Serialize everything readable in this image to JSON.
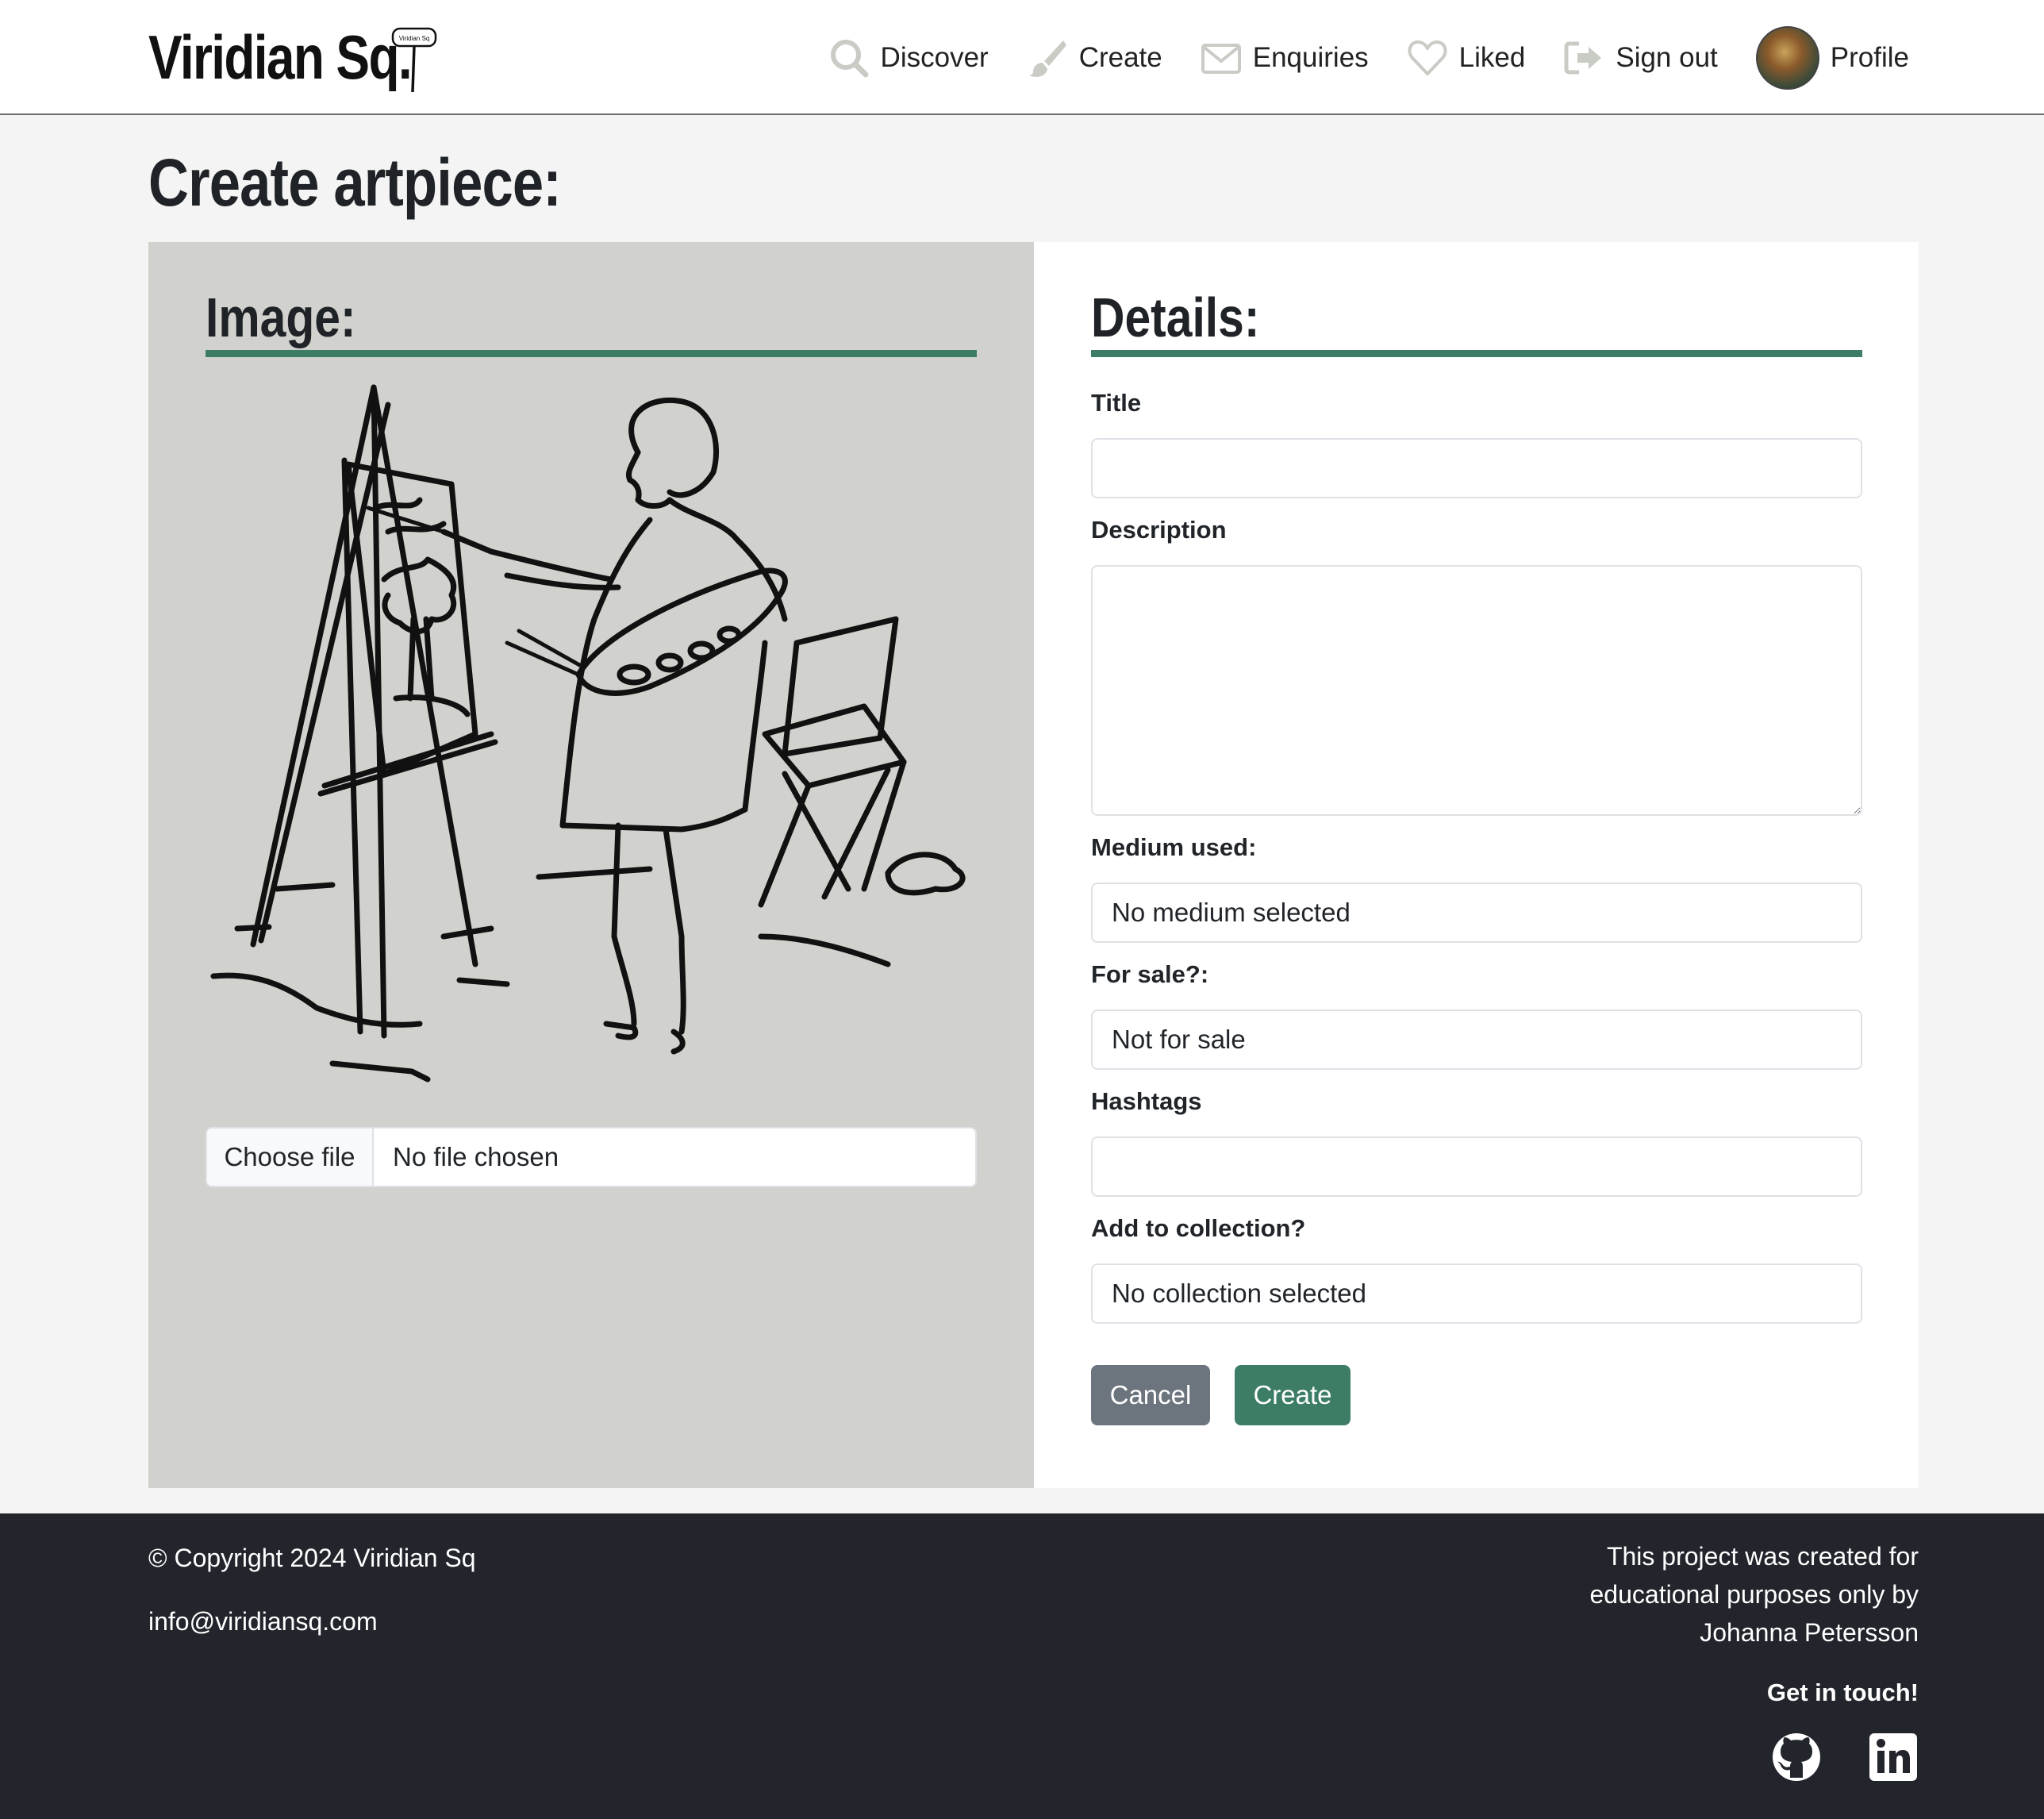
{
  "brand": {
    "name": "Viridian Sq.",
    "sign_text": "Viridian Sq"
  },
  "nav": [
    {
      "label": "Discover",
      "icon": "search-icon"
    },
    {
      "label": "Create",
      "icon": "brush-icon"
    },
    {
      "label": "Enquiries",
      "icon": "envelope-icon"
    },
    {
      "label": "Liked",
      "icon": "heart-icon"
    },
    {
      "label": "Sign out",
      "icon": "sign-out-icon"
    },
    {
      "label": "Profile",
      "icon": "avatar"
    }
  ],
  "page": {
    "title": "Create artpiece:"
  },
  "image_panel": {
    "heading": "Image:",
    "file_button": "Choose file",
    "file_status": "No file chosen"
  },
  "details": {
    "heading": "Details:",
    "title_label": "Title",
    "title_value": "",
    "description_label": "Description",
    "description_value": "",
    "medium_label": "Medium used:",
    "medium_value": "No medium selected",
    "sale_label": "For sale?:",
    "sale_value": "Not for sale",
    "hashtags_label": "Hashtags",
    "hashtags_value": "",
    "collection_label": "Add to collection?",
    "collection_value": "No collection selected",
    "cancel_label": "Cancel",
    "create_label": "Create"
  },
  "footer": {
    "copyright": "© Copyright 2024 Viridian Sq",
    "email": "info@viridiansq.com",
    "note_line1": "This project was created for",
    "note_line2": "educational purposes only by",
    "note_line3": "Johanna Petersson",
    "get_in_touch": "Get in touch!",
    "social": [
      "github-icon",
      "linkedin-icon"
    ]
  },
  "colors": {
    "accent": "#3d7d66",
    "footer_bg": "#22252b",
    "image_panel_bg": "#d1d2cd",
    "cancel": "#6c757d"
  }
}
